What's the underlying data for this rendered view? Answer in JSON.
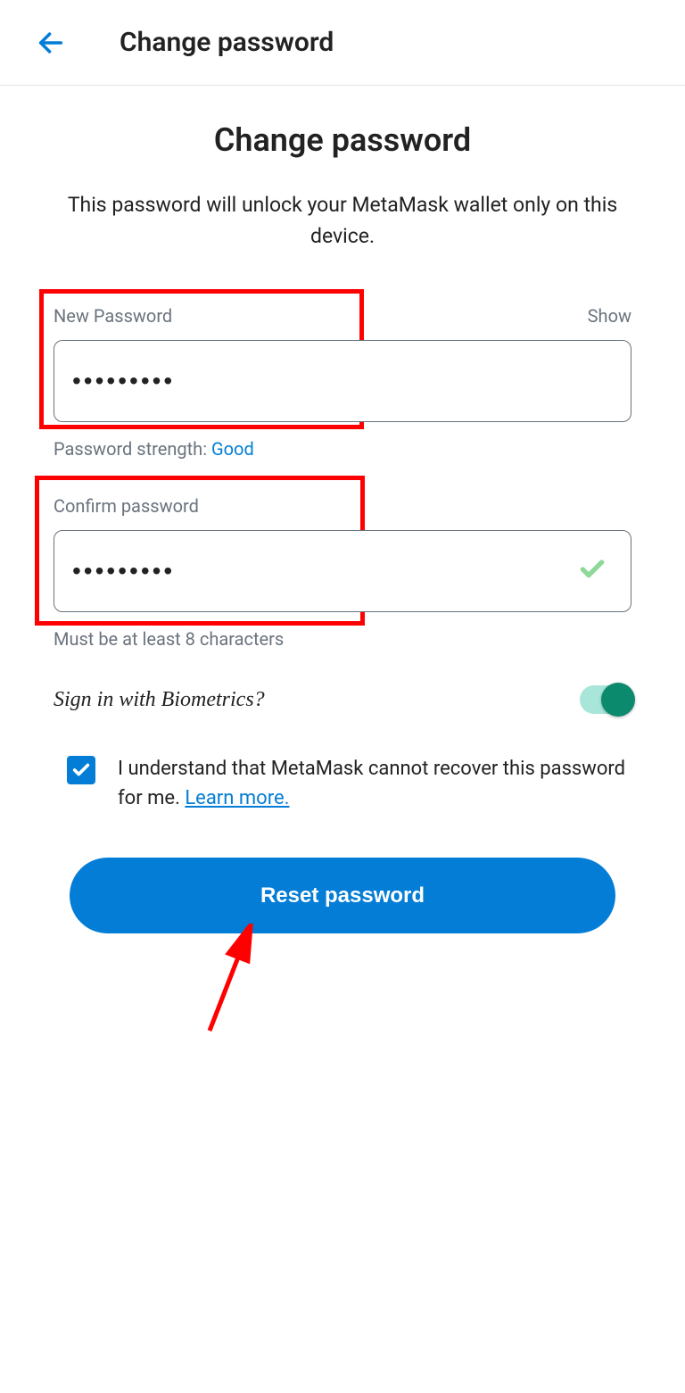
{
  "header": {
    "title": "Change password"
  },
  "main": {
    "title": "Change password",
    "description": "This password will unlock your MetaMask wallet only on this device."
  },
  "newPassword": {
    "label": "New Password",
    "showLabel": "Show",
    "value": "•••••••••",
    "strengthLabel": "Password strength: ",
    "strengthValue": "Good"
  },
  "confirmPassword": {
    "label": "Confirm password",
    "value": "•••••••••",
    "helper": "Must be at least 8 characters"
  },
  "biometrics": {
    "label": "Sign in with Biometrics?",
    "enabled": true
  },
  "consent": {
    "text": "I understand that MetaMask cannot recover this password for me. ",
    "linkText": "Learn more.",
    "checked": true
  },
  "button": {
    "label": "Reset password"
  }
}
